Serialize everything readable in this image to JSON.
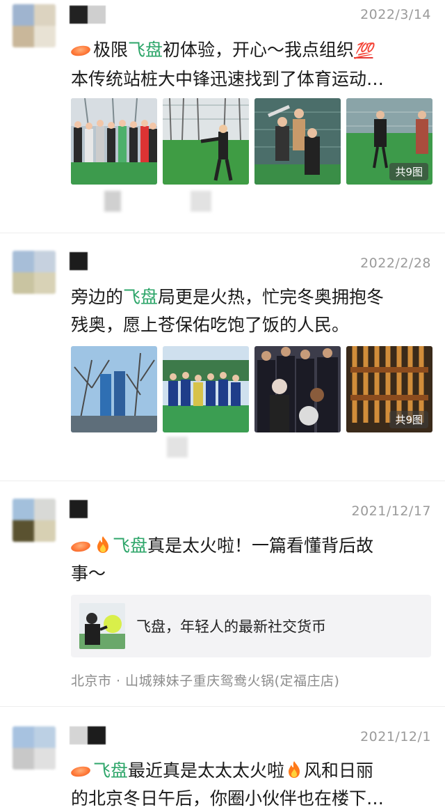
{
  "posts": [
    {
      "date": "2022/3/14",
      "text_line1_pre": "极限",
      "text_line1_hl": "飞盘",
      "text_line1_post": "初体验，开心～我点组织",
      "text_line1_emoji": "💯",
      "text_line2": "本传统站桩大中锋迅速找到了体育运动…",
      "photo_count": "共9图"
    },
    {
      "date": "2022/2/28",
      "text_line1_pre": "旁边的",
      "text_line1_hl": "飞盘",
      "text_line1_post": "局更是火热，忙完冬奥拥抱冬",
      "text_line2": "残奥，愿上苍保佑吃饱了饭的人民。",
      "photo_count": "共9图"
    },
    {
      "date": "2021/12/17",
      "text_line1_hl": "飞盘",
      "text_line1_post": "真是太火啦！一篇看懂背后故",
      "text_line2": "事～",
      "link_title": "飞盘，年轻人的最新社交货币",
      "location": "北京市 · 山城辣妹子重庆鸳鸯火锅(定福庄店)"
    },
    {
      "date": "2021/12/1",
      "text_line1_hl": "飞盘",
      "text_line1_post": "最近真是太太太火啦",
      "text_line1_after": "风和日丽",
      "text_line2": "的北京冬日午后，你圈小伙伴也在楼下…"
    }
  ],
  "icons": {
    "frisbee": "frisbee-icon",
    "fire": "fire-icon",
    "hundred": "hundred-points-icon"
  },
  "colors": {
    "highlight": "#2ea66a",
    "date": "#9a9a9a",
    "text": "#1a1a1a"
  }
}
